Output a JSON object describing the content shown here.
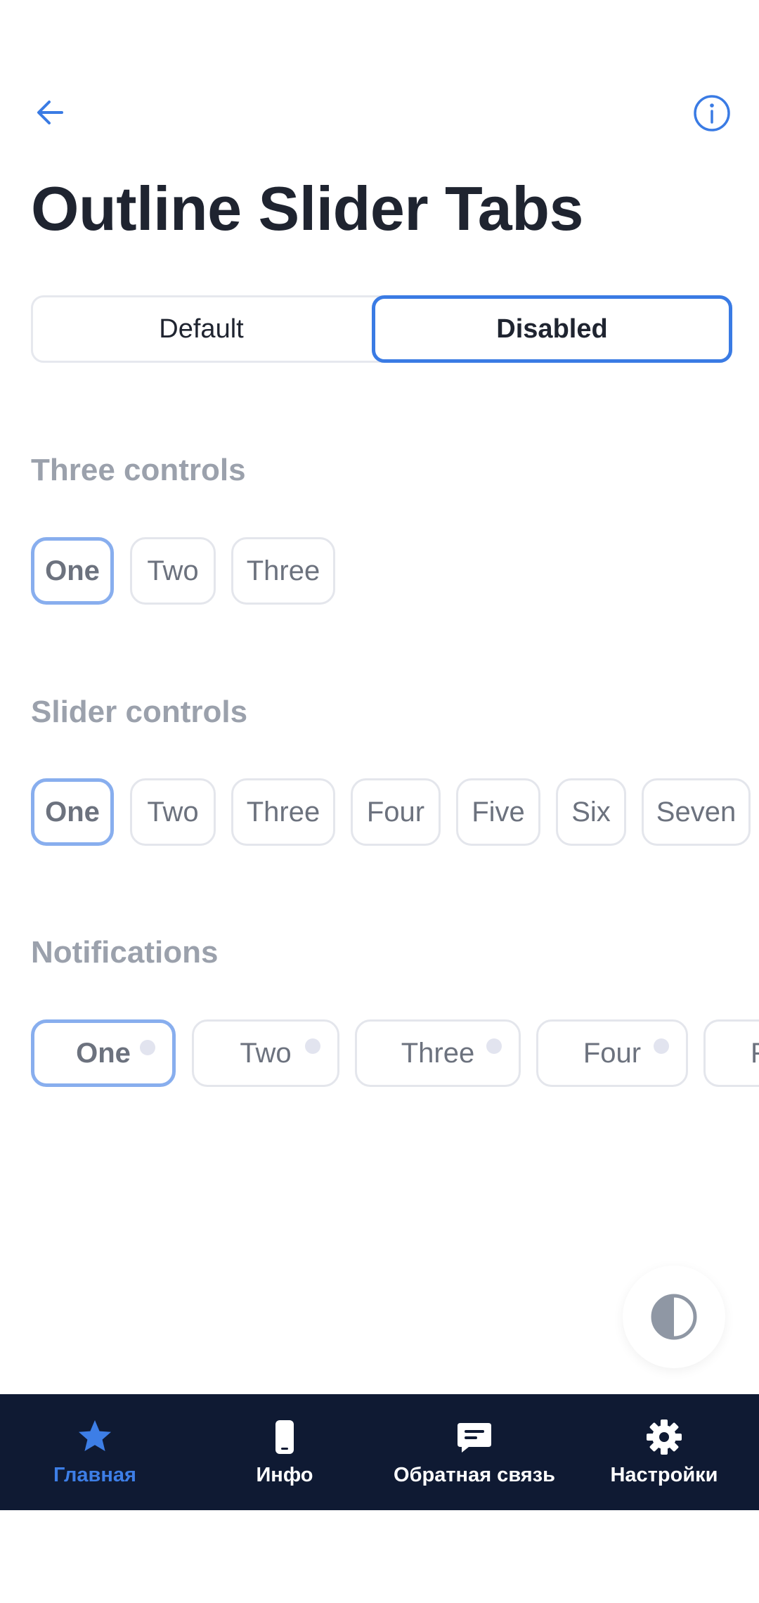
{
  "header": {
    "back_icon": "arrow-left-icon",
    "info_icon": "info-circle-icon",
    "title": "Outline Slider Tabs"
  },
  "segmented": {
    "options": [
      "Default",
      "Disabled"
    ],
    "selected": "Disabled"
  },
  "sections": [
    {
      "title": "Three controls",
      "chips": [
        "One",
        "Two",
        "Three"
      ],
      "selected": "One"
    },
    {
      "title": "Slider controls",
      "chips": [
        "One",
        "Two",
        "Three",
        "Four",
        "Five",
        "Six",
        "Seven"
      ],
      "selected": "One"
    },
    {
      "title": "Notifications",
      "chips": [
        "One",
        "Two",
        "Three",
        "Four",
        "F"
      ],
      "selected": "One"
    }
  ],
  "theme_toggle": {
    "icon": "contrast-icon"
  },
  "bottom_nav": {
    "items": [
      {
        "label": "Главная",
        "icon": "star-icon",
        "active": true
      },
      {
        "label": "Инфо",
        "icon": "phone-icon",
        "active": false
      },
      {
        "label": "Обратная связь",
        "icon": "chat-icon",
        "active": false
      },
      {
        "label": "Настройки",
        "icon": "gear-icon",
        "active": false
      }
    ]
  },
  "colors": {
    "accent": "#3a7be4",
    "active_chip_border": "#88aeee",
    "nav_background": "#0f1a33",
    "section_title": "#9ba1ac"
  }
}
